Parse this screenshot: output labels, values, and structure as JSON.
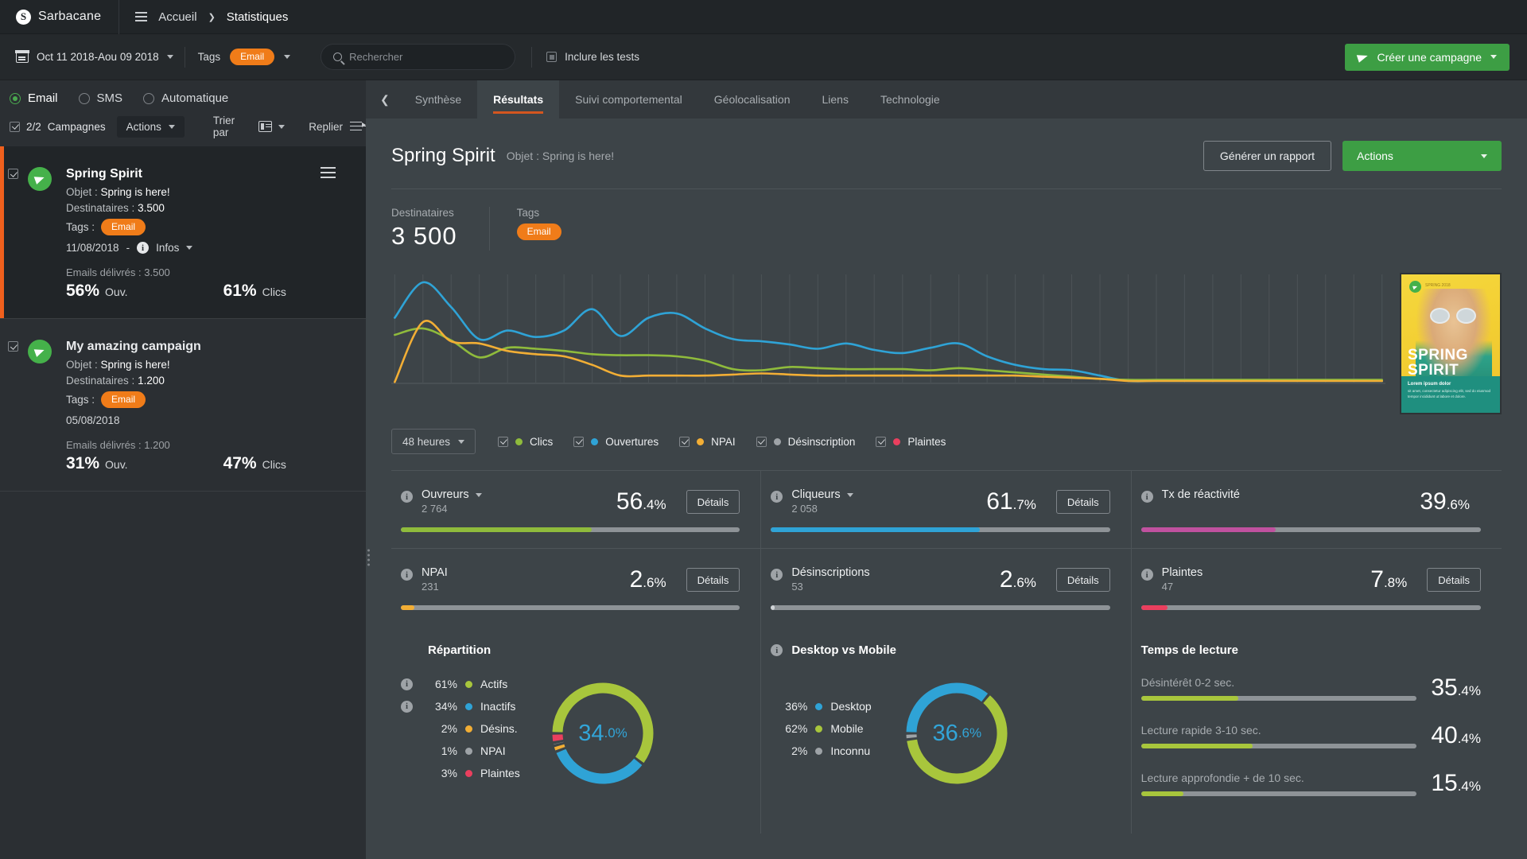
{
  "topbar": {
    "brand_initial": "S",
    "brand": "Sarbacane",
    "menu_icon": "hamburger-icon",
    "breadcrumb": [
      "Accueil",
      "Statistiques"
    ],
    "breadcrumb_sep": "❯"
  },
  "filterbar": {
    "calendar_icon": "calendar-icon",
    "date_range": "Oct 11 2018-Aou 09 2018",
    "tags_label": "Tags",
    "tag_value": "Email",
    "search_placeholder": "Rechercher",
    "include_tests_label": "Inclure les tests",
    "create_campaign_label": "Créer une campagne"
  },
  "sidebar": {
    "channels": [
      {
        "label": "Email",
        "selected": true
      },
      {
        "label": "SMS",
        "selected": false
      },
      {
        "label": "Automatique",
        "selected": false
      }
    ],
    "campaign_count": "2/2",
    "campaign_count_label": "Campagnes",
    "actions_label": "Actions",
    "sort_label": "Trier par",
    "collapse_label": "Replier",
    "campaigns": [
      {
        "title": "Spring Spirit",
        "objet_label": "Objet :",
        "objet": "Spring is here!",
        "dest_label": "Destinataires :",
        "dest": "3.500",
        "tags_label": "Tags :",
        "tag": "Email",
        "date": "11/08/2018",
        "date_sep": "-",
        "infos_label": "Infos",
        "delivered": "Emails délivrés : 3.500",
        "open_pct": "56%",
        "open_lbl": "Ouv.",
        "click_pct": "61%",
        "click_lbl": "Clics",
        "active": true
      },
      {
        "title": "My amazing campaign",
        "objet_label": "Objet :",
        "objet": "Spring is here!",
        "dest_label": "Destinataires :",
        "dest": "1.200",
        "tags_label": "Tags :",
        "tag": "Email",
        "date": "05/08/2018",
        "delivered": "Emails délivrés : 1.200",
        "open_pct": "31%",
        "open_lbl": "Ouv.",
        "click_pct": "47%",
        "click_lbl": "Clics",
        "active": false
      }
    ]
  },
  "main": {
    "tabs": [
      {
        "label": "Synthèse",
        "active": false
      },
      {
        "label": "Résultats",
        "active": true
      },
      {
        "label": "Suivi comportemental",
        "active": false
      },
      {
        "label": "Géolocalisation",
        "active": false
      },
      {
        "label": "Liens",
        "active": false
      },
      {
        "label": "Technologie",
        "active": false
      }
    ],
    "title": "Spring Spirit",
    "subtitle": "Objet : Spring is here!",
    "report_button": "Générer un rapport",
    "actions_button": "Actions",
    "meta": {
      "recipients_label": "Destinataires",
      "recipients_value": "3 500",
      "tags_label": "Tags",
      "tag_value": "Email"
    },
    "thumbnail": {
      "title_line1": "SPRING",
      "title_line2": "SPIRIT",
      "header_brand": "SPRING 2018",
      "band_title": "Lorem ipsum dolor",
      "band_text": "sit amet, consectetur adipiscing elit, sed do eiusmod tempor incididunt ut labore et dolore."
    },
    "period_select": "48 heures",
    "legend": [
      {
        "label": "Clics",
        "color": "#8fbb3c",
        "checked": true
      },
      {
        "label": "Ouvertures",
        "color": "#2fa3d6",
        "checked": true
      },
      {
        "label": "NPAI",
        "color": "#f2ae35",
        "checked": true
      },
      {
        "label": "Désinscription",
        "color": "#9ea3a7",
        "checked": true
      },
      {
        "label": "Plaintes",
        "color": "#ea3f5e",
        "checked": true
      }
    ],
    "metrics": [
      {
        "name": "Ouvreurs",
        "has_caret": true,
        "count": "2 764",
        "pct_int": "56",
        "pct_dec": ".4%",
        "bar_pct": 56.4,
        "color": "#8fbb3c",
        "details": "Détails",
        "has_info": true,
        "has_details": true
      },
      {
        "name": "Cliqueurs",
        "has_caret": true,
        "count": "2 058",
        "pct_int": "61",
        "pct_dec": ".7%",
        "bar_pct": 61.7,
        "color": "#2fa3d6",
        "details": "Détails",
        "has_info": true,
        "has_details": true
      },
      {
        "name": "Tx de réactivité",
        "has_caret": false,
        "count": "",
        "pct_int": "39",
        "pct_dec": ".6%",
        "bar_pct": 39.6,
        "color": "#c0519f",
        "details": "",
        "has_info": true,
        "has_details": false
      },
      {
        "name": "NPAI",
        "has_caret": false,
        "count": "231",
        "pct_int": "2",
        "pct_dec": ".6%",
        "bar_pct": 4.0,
        "color": "#f2ae35",
        "details": "Détails",
        "has_info": true,
        "has_details": true
      },
      {
        "name": "Désinscriptions",
        "has_caret": false,
        "count": "53",
        "pct_int": "2",
        "pct_dec": ".6%",
        "bar_pct": 1.2,
        "color": "#9ea3a7",
        "details": "Détails",
        "has_info": true,
        "has_details": true
      },
      {
        "name": "Plaintes",
        "has_caret": false,
        "count": "47",
        "pct_int": "7",
        "pct_dec": ".8%",
        "bar_pct": 7.8,
        "color": "#ea3f5e",
        "details": "Détails",
        "has_info": true,
        "has_details": true
      }
    ],
    "repartition": {
      "title": "Répartition",
      "center_int": "34",
      "center_dec": ".0%"
    },
    "device": {
      "title": "Desktop vs Mobile",
      "center_int": "36",
      "center_dec": ".6%"
    },
    "reading": {
      "title": "Temps de lecture",
      "rows": [
        {
          "label": "Désintérêt 0-2 sec.",
          "int": "35",
          "dec": ".4%",
          "pct": 35.4
        },
        {
          "label": "Lecture rapide 3-10 sec.",
          "int": "40",
          "dec": ".4%",
          "pct": 40.4
        },
        {
          "label": "Lecture approfondie + de 10 sec.",
          "int": "15",
          "dec": ".4%",
          "pct": 15.4
        }
      ]
    }
  },
  "chart_data": [
    {
      "type": "line",
      "title": "",
      "xlabel": "",
      "ylabel": "",
      "grid": true,
      "legend_position": "below",
      "x": [
        0,
        1,
        2,
        3,
        4,
        5,
        6,
        7,
        8,
        9,
        10,
        11,
        12,
        13,
        14,
        15,
        16,
        17,
        18,
        19,
        20,
        21,
        22,
        23,
        24,
        25,
        26,
        27,
        28,
        29,
        30,
        31,
        32,
        33,
        34,
        35
      ],
      "series": [
        {
          "name": "Ouvertures",
          "color": "#2fa3d6",
          "values": [
            62,
            95,
            72,
            42,
            50,
            44,
            50,
            70,
            45,
            62,
            66,
            52,
            42,
            40,
            37,
            33,
            38,
            32,
            29,
            34,
            38,
            26,
            18,
            14,
            13,
            8,
            3,
            3,
            3,
            3,
            3,
            3,
            3,
            3,
            3,
            3
          ]
        },
        {
          "name": "Clics",
          "color": "#8fbb3c",
          "values": [
            46,
            52,
            41,
            25,
            34,
            33,
            31,
            28,
            27,
            27,
            26,
            22,
            14,
            13,
            16,
            15,
            14,
            14,
            14,
            13,
            15,
            13,
            11,
            9,
            7,
            5,
            4,
            4,
            4,
            4,
            4,
            4,
            4,
            4,
            4,
            4
          ]
        },
        {
          "name": "NPAI",
          "color": "#f2ae35",
          "values": [
            2,
            58,
            40,
            38,
            31,
            28,
            26,
            18,
            8,
            8,
            8,
            8,
            9,
            10,
            9,
            8,
            8,
            8,
            8,
            8,
            8,
            8,
            8,
            7,
            6,
            5,
            3,
            3,
            3,
            3,
            3,
            3,
            3,
            3,
            3,
            3
          ]
        },
        {
          "name": "Désinscription",
          "color": "#9ea3a7",
          "values": [
            0,
            0,
            0,
            0,
            0,
            0,
            0,
            0,
            0,
            0,
            0,
            0,
            0,
            0,
            0,
            0,
            0,
            0,
            0,
            0,
            0,
            0,
            0,
            0,
            0,
            0,
            0,
            0,
            0,
            0,
            0,
            0,
            0,
            0,
            0,
            0
          ]
        },
        {
          "name": "Plaintes",
          "color": "#ea3f5e",
          "values": [
            0,
            0,
            0,
            0,
            0,
            0,
            0,
            0,
            0,
            0,
            0,
            0,
            0,
            0,
            0,
            0,
            0,
            0,
            0,
            0,
            0,
            0,
            0,
            0,
            0,
            0,
            0,
            0,
            0,
            0,
            0,
            0,
            0,
            0,
            0,
            0
          ]
        }
      ]
    },
    {
      "type": "pie",
      "title": "Répartition",
      "labels": [
        "Actifs",
        "Inactifs",
        "Désins.",
        "NPAI",
        "Plaintes"
      ],
      "values": [
        61,
        34,
        2,
        1,
        3
      ],
      "pct_labels": [
        "61%",
        "34%",
        "2%",
        "1%",
        "3%"
      ],
      "colors": [
        "#a8c63c",
        "#2fa3d6",
        "#f2ae35",
        "#9ea3a7",
        "#ea3f5e"
      ],
      "center_label": "34.0%"
    },
    {
      "type": "pie",
      "title": "Desktop vs Mobile",
      "labels": [
        "Desktop",
        "Mobile",
        "Inconnu"
      ],
      "values": [
        36,
        62,
        2
      ],
      "pct_labels": [
        "36%",
        "62%",
        "2%"
      ],
      "colors": [
        "#2fa3d6",
        "#a8c63c",
        "#9ea3a7"
      ],
      "center_label": "36.6%"
    },
    {
      "type": "bar",
      "title": "Temps de lecture",
      "categories": [
        "Désintérêt 0-2 sec.",
        "Lecture rapide 3-10 sec.",
        "Lecture approfondie + de 10 sec."
      ],
      "values": [
        35.4,
        40.4,
        15.4
      ],
      "ylim": [
        0,
        100
      ],
      "color": "#a8c63c"
    }
  ]
}
